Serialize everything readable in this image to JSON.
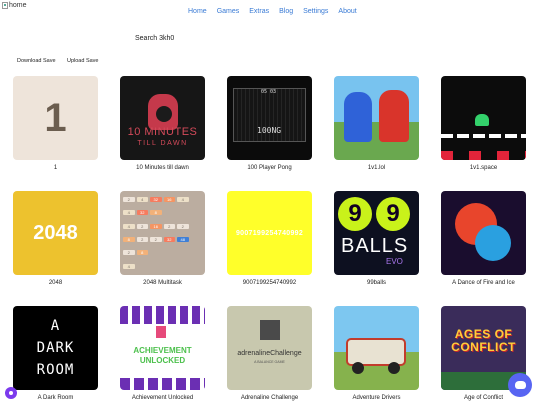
{
  "header": {
    "logo_alt": "home"
  },
  "nav": [
    {
      "label": "Home"
    },
    {
      "label": "Games"
    },
    {
      "label": "Extras"
    },
    {
      "label": "Blog"
    },
    {
      "label": "Settings"
    },
    {
      "label": "About"
    }
  ],
  "search": {
    "label": "Search 3kh0"
  },
  "toolbar": {
    "download_label": "Download Save",
    "upload_label": "Upload Save"
  },
  "games": [
    {
      "title": "1",
      "thumb_text": "1"
    },
    {
      "title": "10 Minutes till dawn",
      "thumb_line1": "10 MINUTES",
      "thumb_line2": "TILL DAWN"
    },
    {
      "title": "100 Player Pong",
      "thumb_score": "05 03",
      "thumb_text": "100NG"
    },
    {
      "title": "1v1.lol"
    },
    {
      "title": "1v1.space"
    },
    {
      "title": "2048",
      "thumb_text": "2048"
    },
    {
      "title": "2048 Multitask"
    },
    {
      "title": "9007199254740992",
      "thumb_text": "9007199254740992"
    },
    {
      "title": "99balls",
      "thumb_digit": "9",
      "thumb_word": "BALLS",
      "thumb_sub": "EVO"
    },
    {
      "title": "A Dance of Fire and Ice"
    },
    {
      "title": "A Dark Room",
      "thumb_lines": [
        "A",
        "DARK",
        "ROOM"
      ]
    },
    {
      "title": "Achievement Unlocked",
      "thumb_line1": "ACHIEVEMENT",
      "thumb_line2": "UNLOCKED"
    },
    {
      "title": "Adrenaline Challenge",
      "thumb_text": "adrenalineChallenge",
      "thumb_sub": "A BALANCE GAME"
    },
    {
      "title": "Adventure Drivers"
    },
    {
      "title": "Age of Conflict",
      "thumb_line1": "AGES OF",
      "thumb_line2": "CONFLICT"
    }
  ],
  "tiles_2048": [
    "2",
    "4",
    "32",
    "16",
    "4",
    "",
    "4",
    "32",
    "8",
    "",
    "",
    "",
    "4",
    "2",
    "16",
    "2",
    "2",
    "",
    "8",
    "2",
    "2",
    "32",
    "48",
    "",
    "2",
    "8",
    "",
    "",
    "",
    "",
    "4",
    "",
    "",
    "",
    "",
    ""
  ]
}
